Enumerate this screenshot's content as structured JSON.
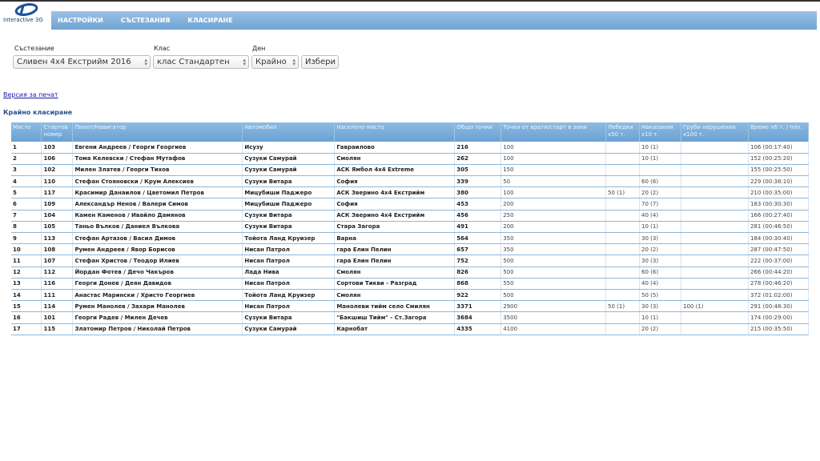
{
  "logo": {
    "text": "Interactive 3G"
  },
  "nav": [
    "НАСТРОЙКИ",
    "СЪСТЕЗАНИЯ",
    "КЛАСИРАНЕ"
  ],
  "filters": {
    "competition_label": "Състезание",
    "competition_value": "Сливен 4x4 Екстрийм 2016",
    "class_label": "Клас",
    "class_value": "клас Стандартен",
    "day_label": "Ден",
    "day_value": "Крайно",
    "submit": "Избери"
  },
  "print_link": "Версия за печат",
  "section_title": "Крайно класиране",
  "columns": [
    "Място",
    "Стартов номер",
    "Пилот/Навигатор",
    "Автомобил",
    "Населено място",
    "Общо точки",
    "Точки от врати/старт в зони",
    "Лебедки x50 т.",
    "Наказания x10 т.",
    "Груби нарушения x100 т.",
    "Време x6 т. / min."
  ],
  "rows": [
    [
      "1",
      "103",
      "Евгени Андреев / Георги Георгиев",
      "Исузу",
      "Гавраилово",
      "216",
      "100",
      "",
      "10 (1)",
      "",
      "106 (00:17:40)"
    ],
    [
      "2",
      "106",
      "Тома Келевски / Стефан Мутафов",
      "Сузуки Самурай",
      "Смолян",
      "262",
      "100",
      "",
      "10 (1)",
      "",
      "152 (00:25:20)"
    ],
    [
      "3",
      "102",
      "Милен Златев / Георги Тихов",
      "Сузуки Самурай",
      "АСК Ямбол 4x4 Extreme",
      "305",
      "150",
      "",
      "",
      "",
      "155 (00:25:50)"
    ],
    [
      "4",
      "110",
      "Стефан Стояновски / Крум Алексиев",
      "Сузуки Витара",
      "София",
      "339",
      "50",
      "",
      "60 (6)",
      "",
      "229 (00:38:10)"
    ],
    [
      "5",
      "117",
      "Красимир Данаилов / Цветомил Петров",
      "Мицубиши Паджеро",
      "АСК Зверино 4x4 Екстрийм",
      "380",
      "100",
      "50 (1)",
      "20 (2)",
      "",
      "210 (00:35:00)"
    ],
    [
      "6",
      "109",
      "Александър Ненов / Валери Симов",
      "Мицубиши Паджеро",
      "София",
      "453",
      "200",
      "",
      "70 (7)",
      "",
      "183 (00:30:30)"
    ],
    [
      "7",
      "104",
      "Камен Каменов / Ивайло Дамянов",
      "Сузуки Витара",
      "АСК Зверино 4x4 Екстрийм",
      "456",
      "250",
      "",
      "40 (4)",
      "",
      "166 (00:27:40)"
    ],
    [
      "8",
      "105",
      "Таньо Вълков / Даниел Вълкова",
      "Сузуки Витара",
      "Стара Загора",
      "491",
      "200",
      "",
      "10 (1)",
      "",
      "281 (00:46:50)"
    ],
    [
      "9",
      "113",
      "Стефан Артазов / Васил Димов",
      "Тойота Ланд Круизер",
      "Варна",
      "564",
      "350",
      "",
      "30 (3)",
      "",
      "184 (00:30:40)"
    ],
    [
      "10",
      "108",
      "Румен Андреев / Явор Борисов",
      "Нисан Патрол",
      "гара Елин Пелин",
      "657",
      "350",
      "",
      "20 (2)",
      "",
      "287 (00:47:50)"
    ],
    [
      "11",
      "107",
      "Стефан Христов / Теодор Илиев",
      "Нисан Патрол",
      "гара Елин Пелин",
      "752",
      "500",
      "",
      "30 (3)",
      "",
      "222 (00:37:00)"
    ],
    [
      "12",
      "112",
      "Йордан Фотев / Дечо Чакъров",
      "Лада Нива",
      "Смолян",
      "826",
      "500",
      "",
      "60 (6)",
      "",
      "266 (00:44:20)"
    ],
    [
      "13",
      "116",
      "Георги Донев / Деян Давидов",
      "Нисан Патрол",
      "Сортови Тикви - Разград",
      "868",
      "550",
      "",
      "40 (4)",
      "",
      "278 (00:46:20)"
    ],
    [
      "14",
      "111",
      "Анастас Марински / Христо Георгиев",
      "Тойота Ланд Круизер",
      "Смолян",
      "922",
      "500",
      "",
      "50 (5)",
      "",
      "372 (01:02:00)"
    ],
    [
      "15",
      "114",
      "Румен Манолев / Захари Манолев",
      "Нисан Патрол",
      "Манолеви тийм село Смилян",
      "3371",
      "2900",
      "50 (1)",
      "30 (3)",
      "100 (1)",
      "291 (00:48:30)"
    ],
    [
      "16",
      "101",
      "Георги Радев / Милен Дечев",
      "Сузуки Витара",
      "\"Бакшиш Тийм\" - Ст.Загора",
      "3684",
      "3500",
      "",
      "10 (1)",
      "",
      "174 (00:29:00)"
    ],
    [
      "17",
      "115",
      "Златомир Петров / Николай Петров",
      "Сузуки Самурай",
      "Карнобат",
      "4335",
      "4100",
      "",
      "20 (2)",
      "",
      "215 (00:35:50)"
    ]
  ]
}
